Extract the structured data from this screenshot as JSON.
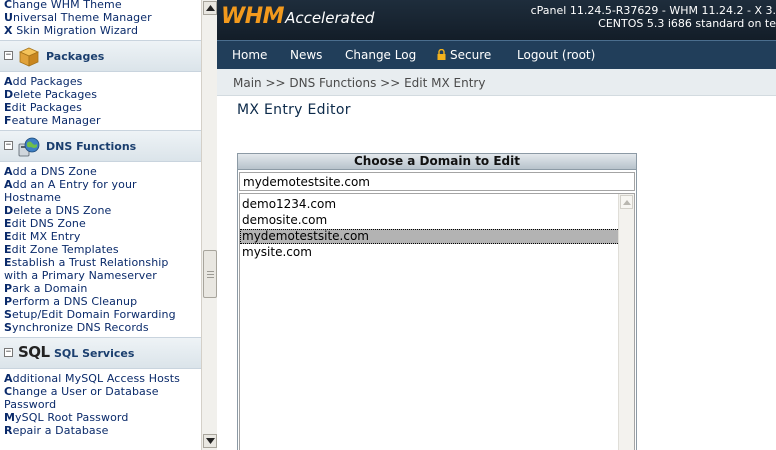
{
  "sidebar": {
    "top_links": [
      {
        "first": "C",
        "rest": "hange WHM Theme"
      },
      {
        "first": "U",
        "rest": "niversal Theme Manager"
      },
      {
        "first": "X",
        "rest": " Skin Migration Wizard"
      }
    ],
    "packages": {
      "title": "Packages",
      "links": [
        {
          "first": "A",
          "rest": "dd Packages"
        },
        {
          "first": "D",
          "rest": "elete Packages"
        },
        {
          "first": "E",
          "rest": "dit Packages"
        },
        {
          "first": "F",
          "rest": "eature Manager"
        }
      ]
    },
    "dns": {
      "title": "DNS Functions",
      "links": [
        {
          "first": "A",
          "rest": "dd a DNS Zone"
        },
        {
          "first": "A",
          "rest": "dd an A Entry for your Hostname"
        },
        {
          "first": "D",
          "rest": "elete a DNS Zone"
        },
        {
          "first": "E",
          "rest": "dit DNS Zone"
        },
        {
          "first": "E",
          "rest": "dit MX Entry"
        },
        {
          "first": "E",
          "rest": "dit Zone Templates"
        },
        {
          "first": "E",
          "rest": "stablish a Trust Relationship with a Primary Nameserver"
        },
        {
          "first": "P",
          "rest": "ark a Domain"
        },
        {
          "first": "P",
          "rest": "erform a DNS Cleanup"
        },
        {
          "first": "S",
          "rest": "etup/Edit Domain Forwarding"
        },
        {
          "first": "S",
          "rest": "ynchronize DNS Records"
        }
      ]
    },
    "sql": {
      "logo": "SQL",
      "title": "SQL Services",
      "links": [
        {
          "first": "A",
          "rest": "dditional MySQL Access Hosts"
        },
        {
          "first": "C",
          "rest": "hange a User or Database Password"
        },
        {
          "first": "M",
          "rest": "ySQL Root Password"
        },
        {
          "first": "R",
          "rest": "epair a Database"
        }
      ]
    },
    "collapse_symbol": "−"
  },
  "header": {
    "logo_whm": "WHM",
    "logo_accel": "Accelerated",
    "build_line1": "cPanel 11.24.5-R37629 - WHM 11.24.2 - X 3.",
    "build_line2": "CENTOS 5.3 i686 standard on te"
  },
  "nav": {
    "home": "Home",
    "news": "News",
    "changelog": "Change Log",
    "secure": "Secure",
    "logout": "Logout (root)"
  },
  "breadcrumb": "Main >> DNS Functions >> Edit MX Entry",
  "page_title": "MX Entry Editor",
  "chooser": {
    "heading": "Choose a Domain to Edit",
    "input_value": "mydemotestsite.com",
    "domains": [
      "demo1234.com",
      "demosite.com",
      "mydemotestsite.com",
      "mysite.com"
    ],
    "selected_index": 2
  },
  "colors": {
    "header_bg": "#1a2836",
    "nav_bg": "#213e5a",
    "logo_orange": "#f39a1d",
    "link_blue": "#0a2a6a"
  }
}
